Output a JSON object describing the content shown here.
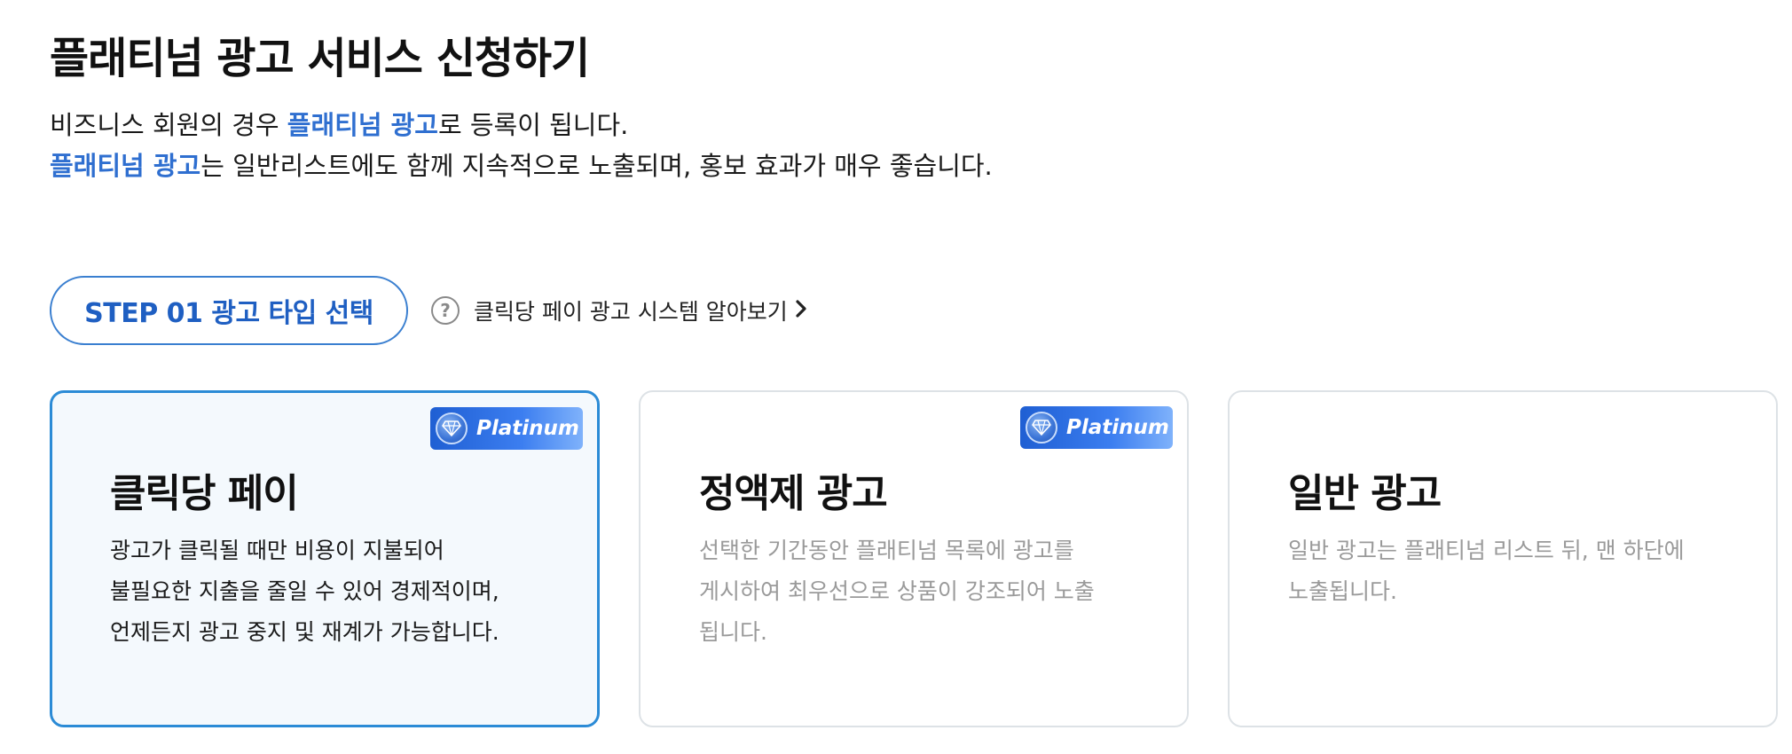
{
  "header": {
    "title": "플래티넘 광고 서비스 신청하기"
  },
  "intro": {
    "line1_pre": "비즈니스 회원의 경우 ",
    "line1_highlight": "플래티넘 광고",
    "line1_post": "로 등록이 됩니다.",
    "line2_highlight": "플래티넘 광고",
    "line2_post": "는 일반리스트에도 함께 지속적으로 노출되며, 홍보 효과가 매우 좋습니다."
  },
  "step": {
    "label": "STEP 01 광고 타입 선택"
  },
  "help": {
    "icon": "question-circle-icon",
    "question_mark": "?",
    "label": "클릭당 페이 광고 시스템 알아보기",
    "chevron": "›"
  },
  "cards": [
    {
      "title": "클릭당 페이",
      "badge": "Platinum",
      "selected": true,
      "desc": [
        "광고가 클릭될 때만 비용이 지불되어",
        "불필요한 지출을 줄일 수 있어 경제적이며,",
        "언제든지 광고 중지 및 재계가 가능합니다."
      ]
    },
    {
      "title": "정액제 광고",
      "badge": "Platinum",
      "selected": false,
      "desc": [
        "선택한 기간동안 플래티넘 목록에 광고를",
        "게시하여 최우선으로 상품이 강조되어 노출",
        "됩니다."
      ]
    },
    {
      "title": "일반 광고",
      "selected": false,
      "desc": [
        "일반 광고는 플래티넘 리스트 뒤, 맨 하단에",
        "노출됩니다."
      ]
    }
  ],
  "colors": {
    "accent": "#2f6fd0",
    "selected_border": "#2b8bd6",
    "selected_bg": "#f4f9fd",
    "muted_text": "#9a9a9a"
  }
}
